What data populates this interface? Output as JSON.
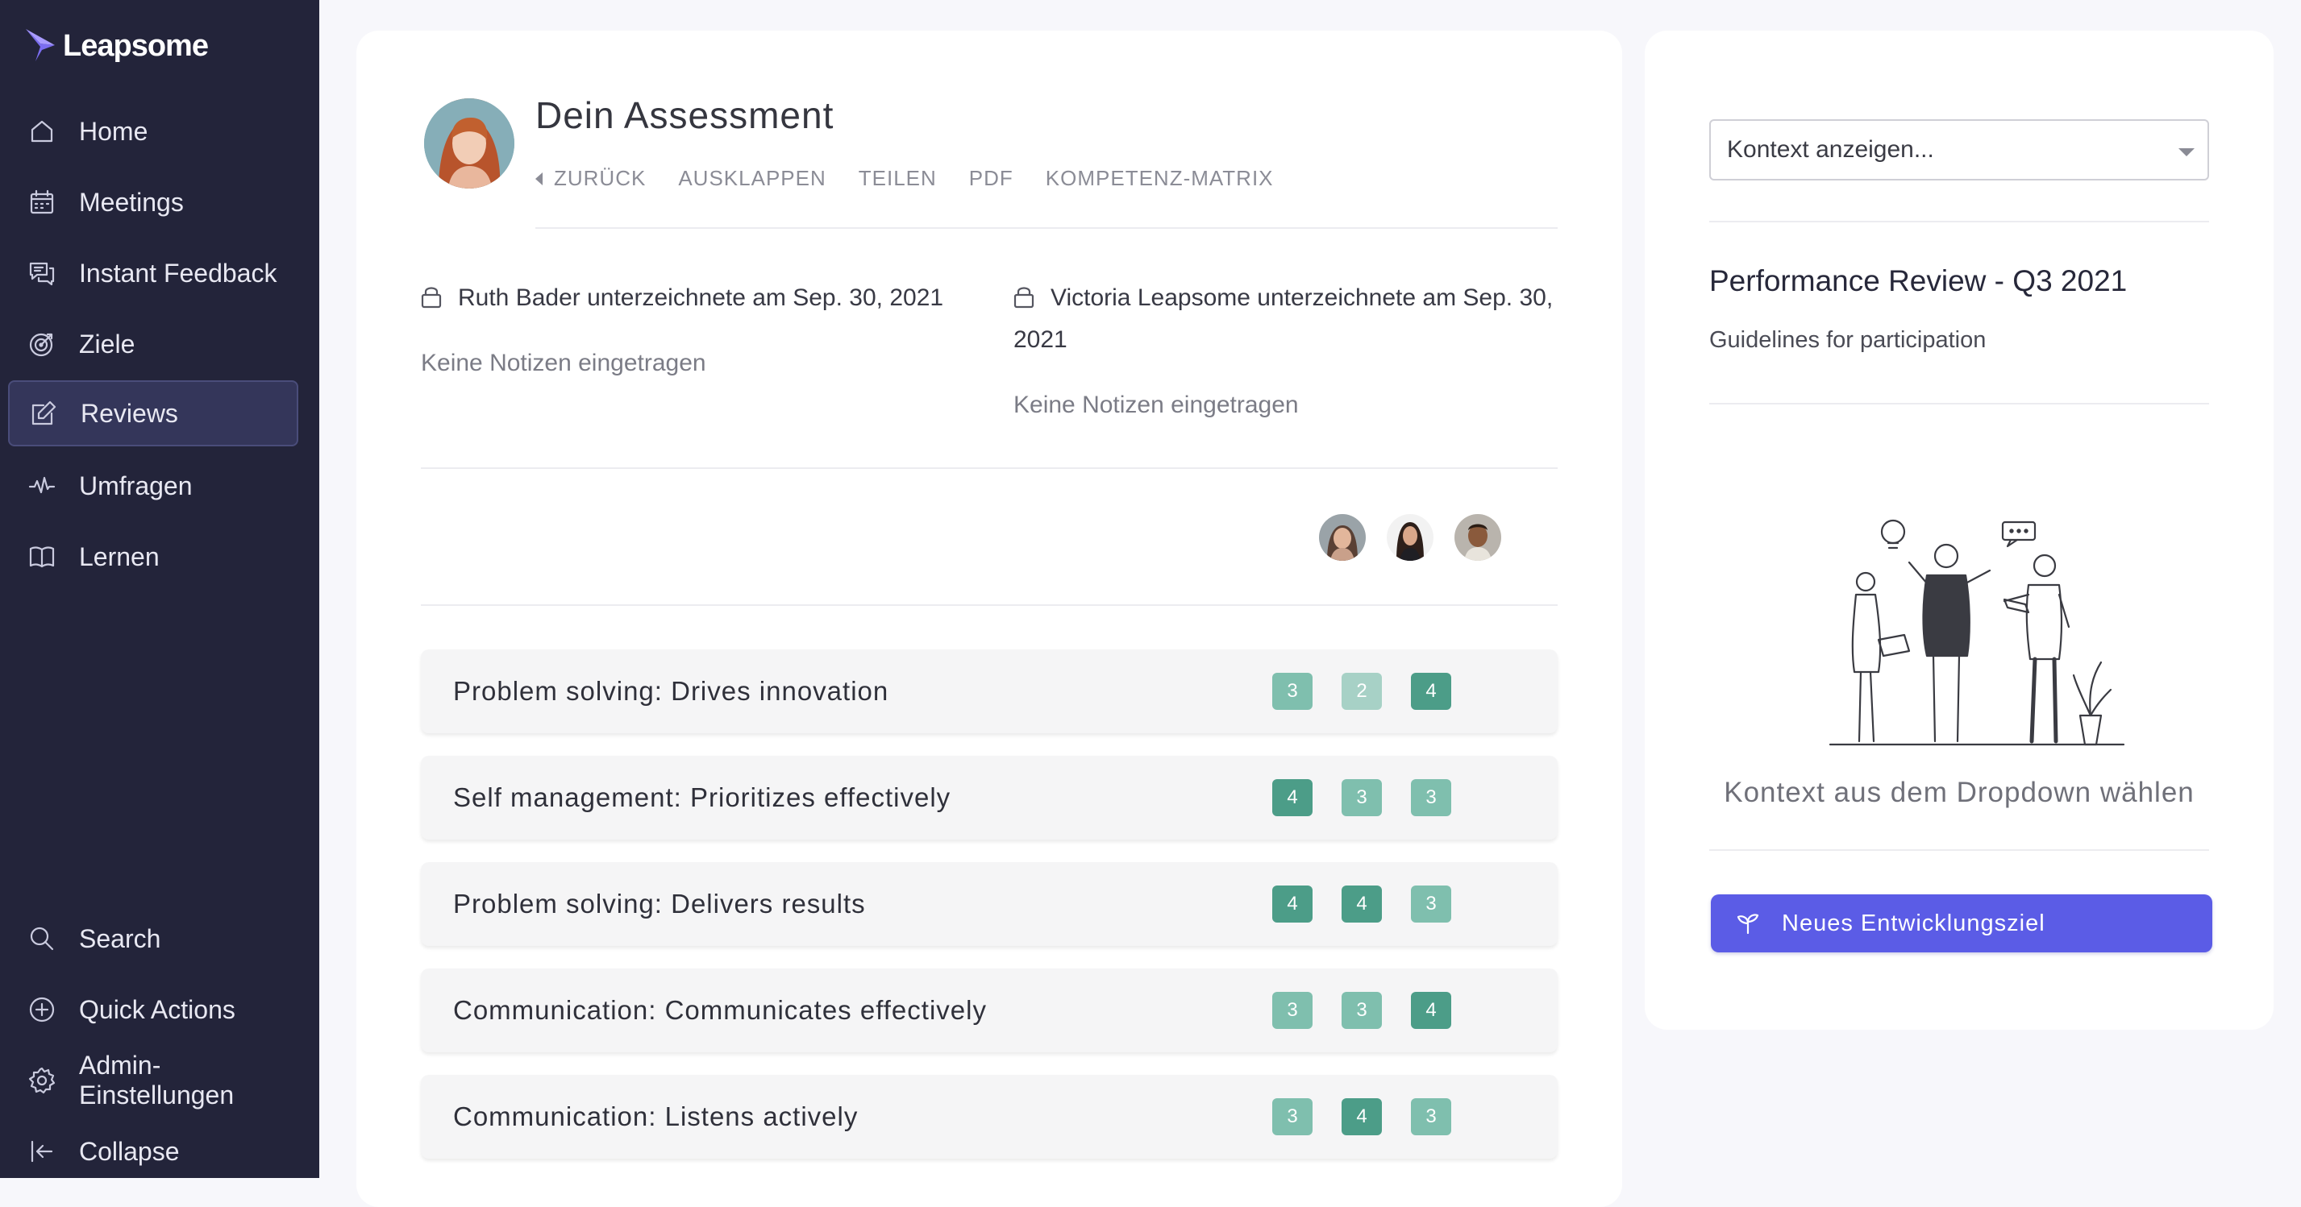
{
  "brand": {
    "name": "Leapsome"
  },
  "sidebar": {
    "items": [
      {
        "label": "Home",
        "icon": "home-icon"
      },
      {
        "label": "Meetings",
        "icon": "calendar-icon"
      },
      {
        "label": "Instant Feedback",
        "icon": "chat-icon"
      },
      {
        "label": "Ziele",
        "icon": "target-icon"
      },
      {
        "label": "Reviews",
        "icon": "edit-icon",
        "active": true
      },
      {
        "label": "Umfragen",
        "icon": "pulse-icon"
      },
      {
        "label": "Lernen",
        "icon": "book-icon"
      }
    ],
    "bottom_items": [
      {
        "label": "Search",
        "icon": "search-icon"
      },
      {
        "label": "Quick Actions",
        "icon": "plus-circle-icon"
      },
      {
        "label": "Admin-Einstellungen",
        "icon": "gear-icon"
      },
      {
        "label": "Collapse",
        "icon": "collapse-icon"
      }
    ]
  },
  "assessment": {
    "title": "Dein Assessment",
    "actions": {
      "back": "ZURÜCK",
      "expand": "AUSKLAPPEN",
      "share": "TEILEN",
      "pdf": "PDF",
      "matrix": "KOMPETENZ-MATRIX"
    },
    "signatures": [
      {
        "text": "Ruth Bader unterzeichnete am Sep. 30, 2021",
        "note": "Keine Notizen eingetragen"
      },
      {
        "text": "Victoria Leapsome unterzeichnete am Sep. 30, 2021",
        "note": "Keine Notizen eingetragen"
      }
    ],
    "competencies": [
      {
        "label": "Problem solving: Drives innovation",
        "scores": [
          "3",
          "2",
          "4"
        ]
      },
      {
        "label": "Self management: Prioritizes effectively",
        "scores": [
          "4",
          "3",
          "3"
        ]
      },
      {
        "label": "Problem solving: Delivers results",
        "scores": [
          "4",
          "4",
          "3"
        ]
      },
      {
        "label": "Communication: Communicates effectively",
        "scores": [
          "3",
          "3",
          "4"
        ]
      },
      {
        "label": "Communication: Listens actively",
        "scores": [
          "3",
          "4",
          "3"
        ]
      }
    ],
    "score_colors": {
      "2": "#a7d1c6",
      "3": "#7fbfae",
      "4": "#4c9d88"
    }
  },
  "context": {
    "select_value": "Kontext anzeigen...",
    "review_title": "Performance Review - Q3 2021",
    "review_subtitle": "Guidelines for participation",
    "hint": "Kontext aus dem Dropdown wählen",
    "new_goal_button": "Neues Entwicklungsziel"
  },
  "colors": {
    "sidebar_bg": "#23243a",
    "accent": "#5b5ce6"
  }
}
